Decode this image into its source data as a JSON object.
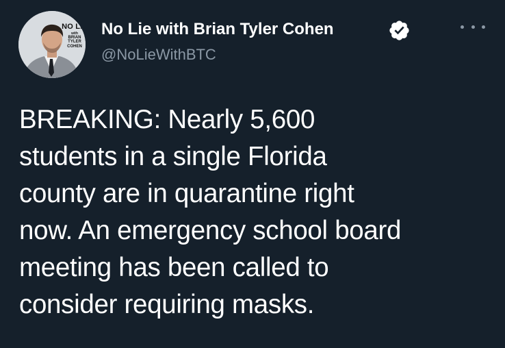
{
  "author": {
    "display_name": "No Lie with Brian Tyler Cohen",
    "handle": "@NoLieWithBTC",
    "verified": true,
    "avatar_logo": {
      "line1": "NO LIE",
      "line2": "with",
      "line3": "BRIAN\nTYLER\nCOHEN"
    }
  },
  "tweet": {
    "text": "BREAKING: Nearly 5,600\nstudents in a single Florida\ncounty are in quarantine right\nnow. An emergency school board\nmeeting has been called to\nconsider requiring masks."
  },
  "icons": {
    "verified": "verified-badge-icon",
    "more": "more-options-icon"
  },
  "colors": {
    "background": "#15202b",
    "text": "#ffffff",
    "muted": "#8b98a5"
  }
}
